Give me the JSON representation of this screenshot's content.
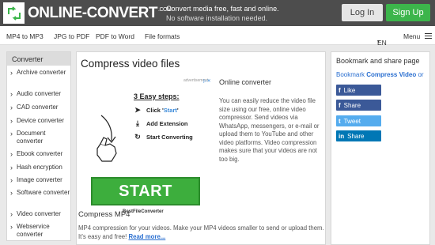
{
  "header": {
    "logo_text": "ONLINE-CONVERT",
    "logo_suffix": ".COM",
    "tagline": "Convert media free, fast and online.",
    "subtagline": "No software installation needed.",
    "login_label": "Log In",
    "signup_label": "Sign Up",
    "colors": {
      "header_bg": "#4d4d4d",
      "signup": "#3cb54b"
    }
  },
  "nav": {
    "links": [
      "MP4 to MP3",
      "JPG to PDF",
      "PDF to Word",
      "File formats"
    ],
    "language": "EN",
    "menu_label": "Menu"
  },
  "sidebar": {
    "heading": "Converter",
    "items": [
      "Archive converter",
      "Audio converter",
      "CAD converter",
      "Device converter",
      "Document converter",
      "Ebook converter",
      "Hash encryption",
      "Image converter",
      "Software converter",
      "Video converter",
      "Webservice converter"
    ]
  },
  "main": {
    "title": "Compress video files",
    "ad": {
      "label": "advertisement",
      "steps_title": "3 Easy steps:",
      "step1_prefix": "Click '",
      "step1_highlight": "Start",
      "step1_suffix": "'",
      "step2": "Add Extension",
      "step3": "Start Converting",
      "start_label": "START",
      "brand": "BestFileConverter"
    },
    "online_converter_heading": "Online converter",
    "online_converter_text": "You can easily reduce the video file size using our free, online video compressor. Send videos via WhatsApp, messengers, or e-mail or upload them to YouTube and other video platforms. Video compression makes sure that your videos are not too big.",
    "compress_heading": "Compress MP4",
    "compress_text": "MP4 compression for your videos. Make your MP4 videos smaller to send or upload them. It's easy and free!",
    "read_more": "Read more..."
  },
  "right": {
    "heading": "Bookmark and share page",
    "bookmark_prefix": "Bookmark",
    "bookmark_bold": "Compress Video",
    "bookmark_suffix": "or",
    "share_buttons": [
      {
        "label": "Like",
        "glyph": "f",
        "color": "#3b5998"
      },
      {
        "label": "Share",
        "glyph": "f",
        "color": "#3b5998"
      },
      {
        "label": "Tweet",
        "glyph": "t",
        "color": "#55acee"
      },
      {
        "label": "Share",
        "glyph": "in",
        "color": "#0077b5"
      }
    ]
  }
}
